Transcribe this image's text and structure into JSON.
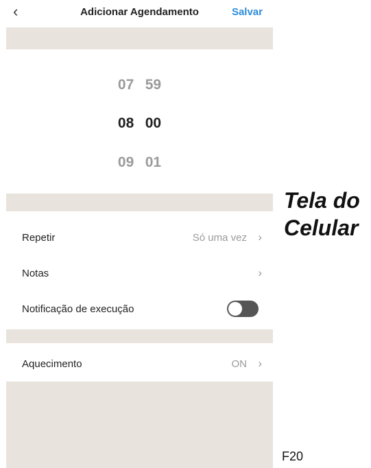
{
  "header": {
    "back_icon": "chevron-left-icon",
    "back_glyph": "‹",
    "title": "Adicionar Agendamento",
    "save_label": "Salvar"
  },
  "picker": {
    "rows": [
      {
        "hour": "07",
        "minute": "59"
      },
      {
        "hour": "08",
        "minute": "00"
      },
      {
        "hour": "09",
        "minute": "01"
      }
    ]
  },
  "settings": {
    "repeat": {
      "label": "Repetir",
      "value": "Só uma vez"
    },
    "notes": {
      "label": "Notas"
    },
    "notification": {
      "label": "Notificação de execução",
      "enabled": false
    },
    "heating": {
      "label": "Aquecimento",
      "value": "ON"
    },
    "chevron_glyph": "›"
  },
  "annotation": {
    "line1": "Tela do",
    "line2": "Celular",
    "figure": "F20"
  },
  "colors": {
    "accent": "#2d8cd9",
    "band": "#e8e4dd",
    "toggle_off": "#555555"
  }
}
